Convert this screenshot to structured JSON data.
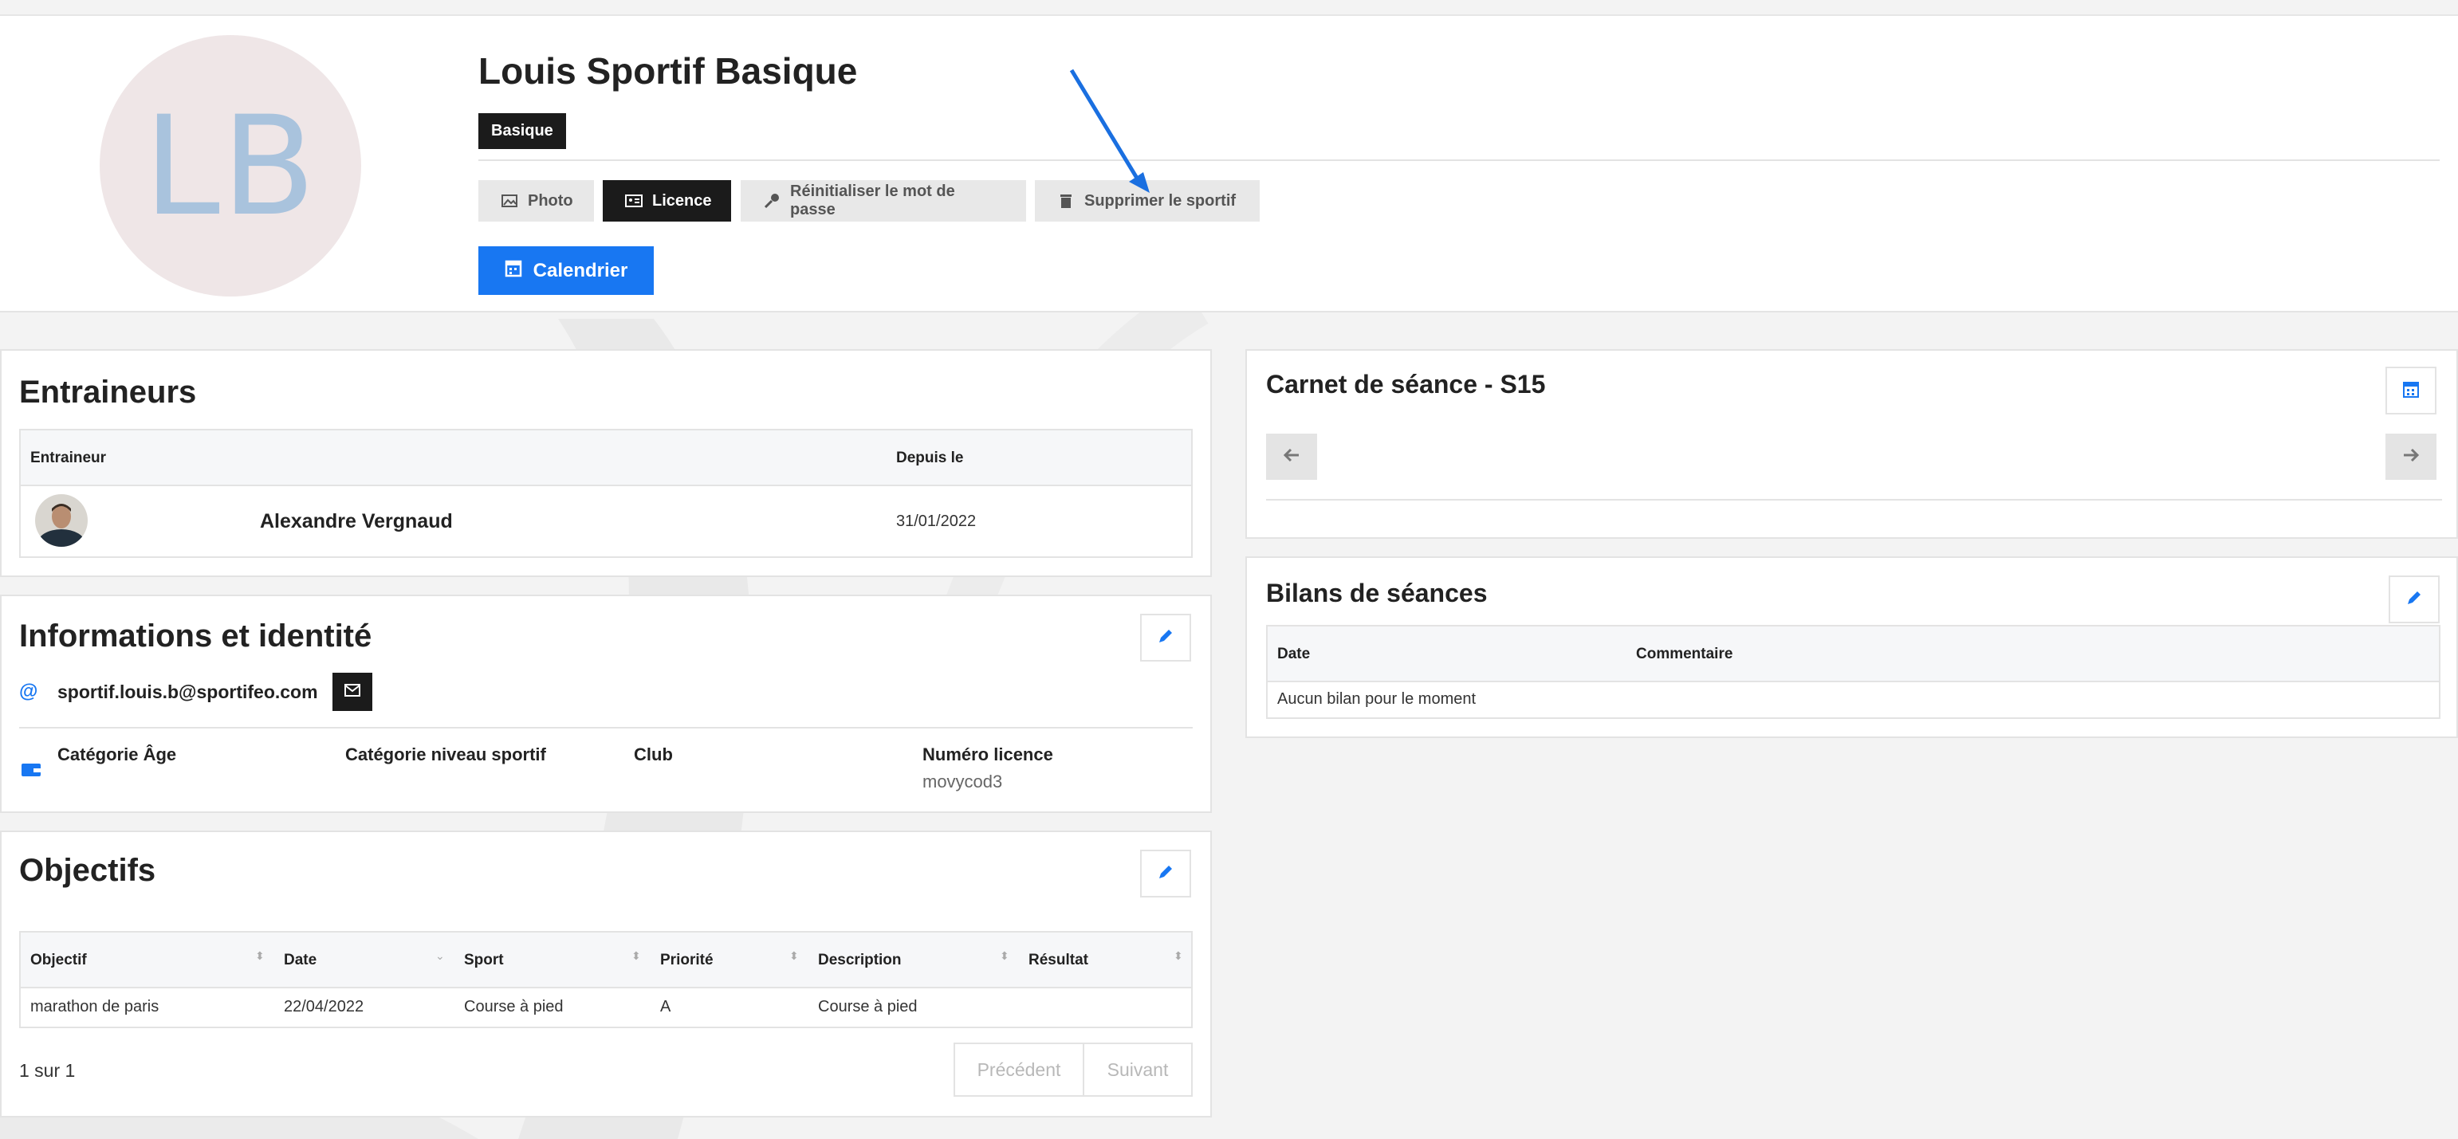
{
  "profile": {
    "initials": "LB",
    "name": "Louis Sportif Basique",
    "level_badge": "Basique",
    "actions": {
      "photo": "Photo",
      "licence": "Licence",
      "reset_password": "Réinitialiser le mot de passe",
      "delete": "Supprimer le sportif"
    },
    "calendar_button": "Calendrier"
  },
  "coaches": {
    "title": "Entraineurs",
    "columns": [
      "Entraineur",
      "Depuis le"
    ],
    "rows": [
      {
        "name": "Alexandre Vergnaud",
        "since": "31/01/2022"
      }
    ]
  },
  "info": {
    "title": "Informations et identité",
    "email": "sportif.louis.b@sportifeo.com",
    "fields": [
      {
        "label": "Catégorie Âge",
        "value": ""
      },
      {
        "label": "Catégorie niveau sportif",
        "value": ""
      },
      {
        "label": "Club",
        "value": ""
      },
      {
        "label": "Numéro licence",
        "value": "movycod3"
      }
    ]
  },
  "goals": {
    "title": "Objectifs",
    "columns": [
      "Objectif",
      "Date",
      "Sport",
      "Priorité",
      "Description",
      "Résultat"
    ],
    "rows": [
      [
        "marathon de paris",
        "22/04/2022",
        "Course à pied",
        "A",
        "Course à pied",
        ""
      ]
    ],
    "pagination_text": "1 sur 1",
    "prev_label": "Précédent",
    "next_label": "Suivant"
  },
  "carnet": {
    "title": "Carnet de séance - S15"
  },
  "bilans": {
    "title": "Bilans de séances",
    "columns": [
      "Date",
      "Commentaire"
    ],
    "empty_text": "Aucun bilan pour le moment"
  },
  "colors": {
    "accent": "#1877f2",
    "dark": "#1b1b1b",
    "annotation_arrow": "#1a6fe0"
  }
}
